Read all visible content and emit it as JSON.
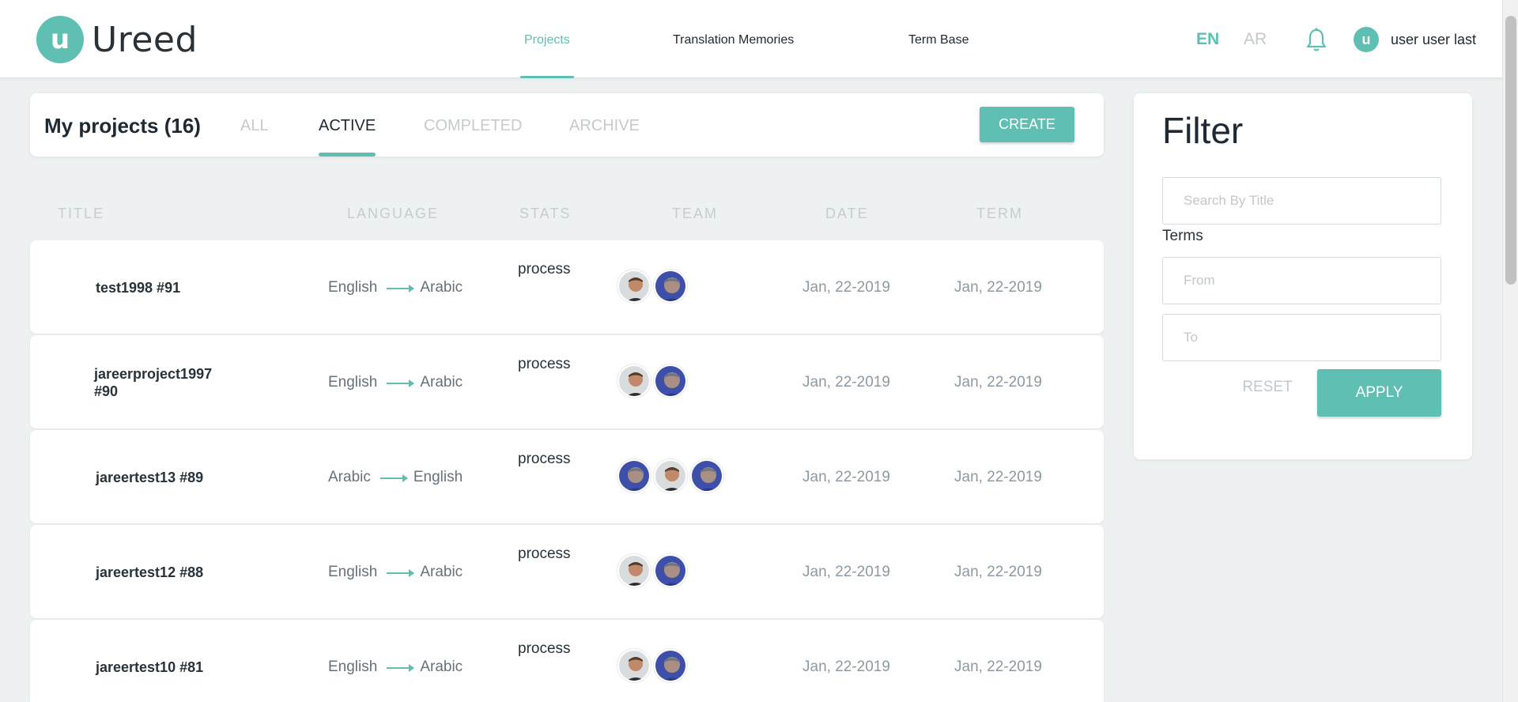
{
  "brand": {
    "logo_letter": "u",
    "name": "Ureed"
  },
  "nav": {
    "items": [
      {
        "label": "Projects",
        "active": true
      },
      {
        "label": "Translation Memories",
        "active": false
      },
      {
        "label": "Term Base",
        "active": false
      }
    ]
  },
  "languages": {
    "en": "EN",
    "ar": "AR",
    "selected": "EN"
  },
  "user": {
    "avatar_letter": "u",
    "name": "user user last"
  },
  "projects_panel": {
    "title": "My projects (16)",
    "tabs": [
      {
        "label": "ALL",
        "active": false
      },
      {
        "label": "ACTIVE",
        "active": true
      },
      {
        "label": "COMPLETED",
        "active": false
      },
      {
        "label": "ARCHIVE",
        "active": false
      }
    ],
    "create_label": "CREATE"
  },
  "table": {
    "columns": [
      "TITLE",
      "LANGUAGE",
      "STATS",
      "TEAM",
      "DATE",
      "TERM"
    ],
    "rows": [
      {
        "title": "test1998 #91",
        "source": "English",
        "target": "Arabic",
        "stats": "process",
        "team": [
          "member-a",
          "member-b"
        ],
        "date": "Jan, 22-2019",
        "term": "Jan, 22-2019"
      },
      {
        "title": "jareerproject1997 #90",
        "source": "English",
        "target": "Arabic",
        "stats": "process",
        "team": [
          "member-a",
          "member-b"
        ],
        "date": "Jan, 22-2019",
        "term": "Jan, 22-2019"
      },
      {
        "title": "jareertest13 #89",
        "source": "Arabic",
        "target": "English",
        "stats": "process",
        "team": [
          "member-b",
          "member-a",
          "member-b"
        ],
        "date": "Jan, 22-2019",
        "term": "Jan, 22-2019"
      },
      {
        "title": "jareertest12 #88",
        "source": "English",
        "target": "Arabic",
        "stats": "process",
        "team": [
          "member-a",
          "member-b"
        ],
        "date": "Jan, 22-2019",
        "term": "Jan, 22-2019"
      },
      {
        "title": "jareertest10 #81",
        "source": "English",
        "target": "Arabic",
        "stats": "process",
        "team": [
          "member-a",
          "member-b"
        ],
        "date": "Jan, 22-2019",
        "term": "Jan, 22-2019"
      }
    ]
  },
  "filter": {
    "title": "Filter",
    "search_placeholder": "Search By Title",
    "search_value": "",
    "terms_label": "Terms",
    "from_placeholder": "From",
    "to_placeholder": "To",
    "reset_label": "RESET",
    "apply_label": "APPLY"
  },
  "colors": {
    "accent": "#5fbfb2",
    "muted": "#c2c8cc",
    "background": "#eef1f1"
  }
}
